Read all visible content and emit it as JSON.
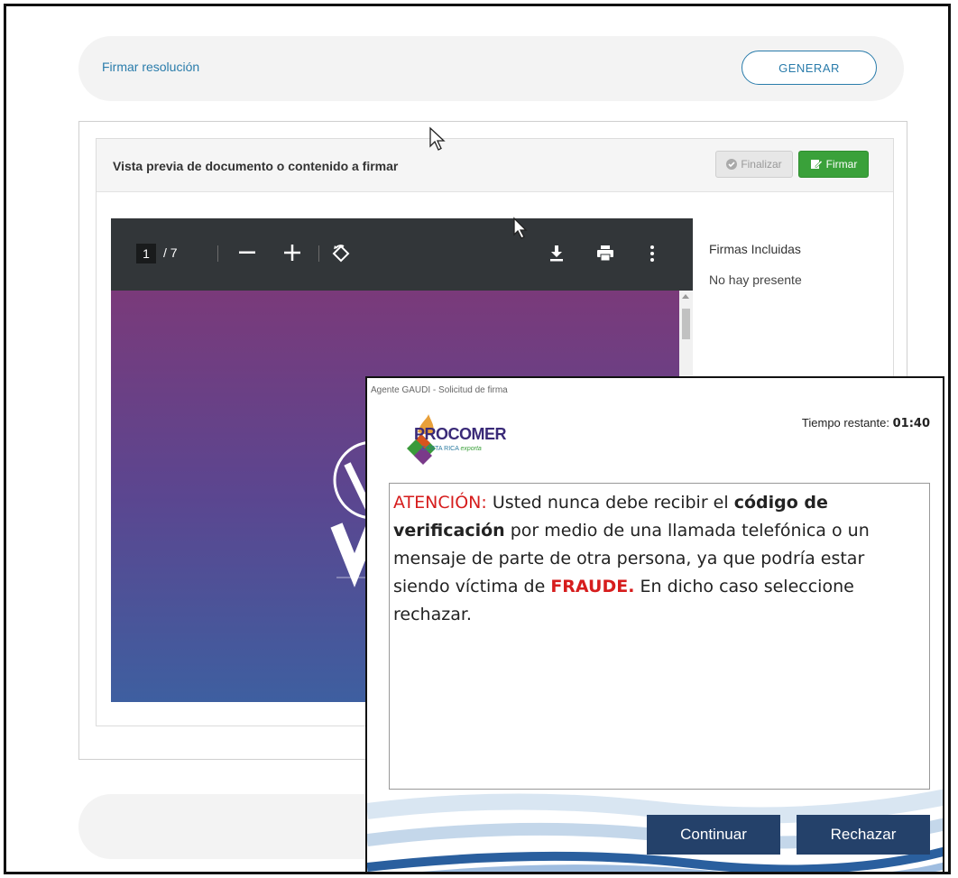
{
  "section": {
    "title": "Firmar resolución",
    "generate_label": "GENERAR"
  },
  "preview": {
    "caption": "Vista previa de documento o contenido a firmar",
    "finalize_label": "Finalizar",
    "sign_label": "Firmar"
  },
  "pdf_viewer": {
    "current_page": "1",
    "total_pages": "/ 7",
    "icons": [
      "zoom-out-icon",
      "zoom-in-icon",
      "rotate-icon",
      "download-icon",
      "print-icon",
      "more-icon"
    ]
  },
  "signatures": {
    "heading": "Firmas Incluidas",
    "status": "No hay presente"
  },
  "dialog": {
    "window_title": "Agente GAUDI - Solicitud de firma",
    "timer_label": "Tiempo restante:",
    "timer_value": "01:40",
    "logo_name": "PROCOMER",
    "logo_tagline_a": "COSTA RICA",
    "logo_tagline_b": "exporta",
    "message": {
      "attention": "ATENCIÓN:",
      "part1": " Usted nunca debe recibir el ",
      "code": "código de verificación",
      "part2": " por medio de una llamada telefónica o un mensaje de parte de otra persona, ya que podría estar siendo víctima de ",
      "fraud": "FRAUDE.",
      "part3": " En dicho caso seleccione rechazar."
    },
    "continue_label": "Continuar",
    "reject_label": "Rechazar"
  },
  "colors": {
    "link_blue": "#2a7cab",
    "sign_green": "#3aa13a",
    "dialog_button": "#24416a",
    "warning_red": "#d61d1d"
  }
}
